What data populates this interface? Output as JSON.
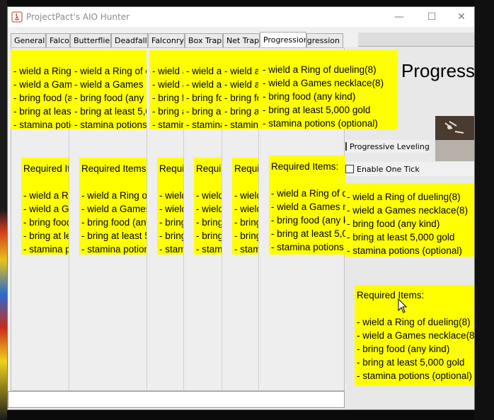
{
  "window": {
    "title": "ProjectPact's AIO Hunter",
    "controls": {
      "minimize": "—",
      "maximize": "☐",
      "close": "✕"
    }
  },
  "tabs": [
    {
      "label": "General"
    },
    {
      "label": "Falconry"
    },
    {
      "label": "Butterflies"
    },
    {
      "label": "Deadfall"
    },
    {
      "label": "Falconry"
    },
    {
      "label": "Box Trap"
    },
    {
      "label": "Net Trap"
    },
    {
      "label": "Progression",
      "active": true
    },
    {
      "label": "Progression"
    }
  ],
  "requirements": {
    "heading": "Required Items:",
    "items": [
      "- wield a Ring of dueling(8)",
      "- wield a Games necklace(8)",
      "- bring food (any kind)",
      "- bring at least 5,000 gold",
      "- stamina potions (optional)"
    ]
  },
  "right_panel": {
    "title": "Progression",
    "options": {
      "progressive_leveling": "Progressive Leveling",
      "enable_one_tick": "Enable One Tick"
    }
  },
  "colors": {
    "note_bg": "#ffff00",
    "window_bg": "#f0f0f0"
  }
}
